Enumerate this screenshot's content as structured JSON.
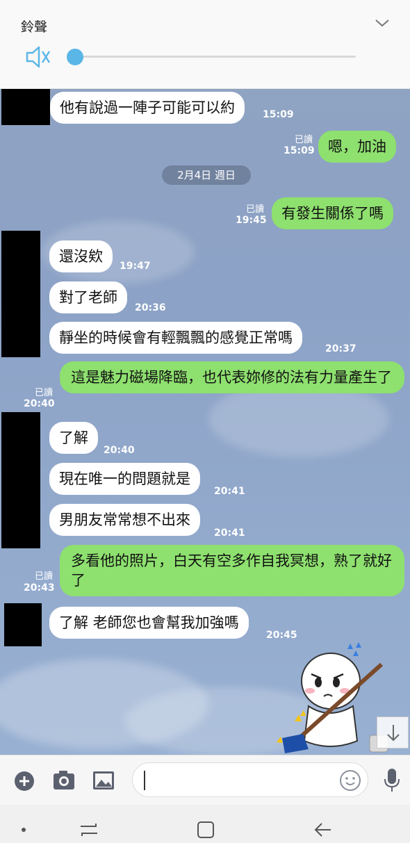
{
  "volume": {
    "title": "鈴聲",
    "level": 0.0,
    "muted": true
  },
  "chat": {
    "date_divider": "2月4日 週日",
    "messages": [
      {
        "side": "in",
        "text": "他有說過一陣子可能可以約",
        "time": "15:09"
      },
      {
        "side": "out",
        "text": "嗯，加油",
        "time": "15:09",
        "read": "已讀"
      },
      {
        "side": "out",
        "text": "有發生關係了嗎",
        "time": "19:45",
        "read": "已讀"
      },
      {
        "side": "in",
        "text": "還沒欸",
        "time": "19:47"
      },
      {
        "side": "in",
        "text": "對了老師",
        "time": "20:36"
      },
      {
        "side": "in",
        "text": "靜坐的時候會有輕飄飄的感覺正常嗎",
        "time": "20:37"
      },
      {
        "side": "out",
        "text": "這是魅力磁場降臨，也代表妳修的法有力量產生了",
        "time": "20:40",
        "read": "已讀"
      },
      {
        "side": "in",
        "text": "了解",
        "time": "20:40"
      },
      {
        "side": "in",
        "text": "現在唯一的問題就是",
        "time": "20:41"
      },
      {
        "side": "in",
        "text": "男朋友常常想不出來",
        "time": "20:41"
      },
      {
        "side": "out",
        "text": "多看他的照片，白天有空多作自我冥想，熟了就好了",
        "time": "20:43",
        "read": "已讀"
      },
      {
        "side": "in",
        "text": "了解 老師您也會幫我加強嗎",
        "time": "20:45"
      }
    ]
  },
  "input": {
    "value": "",
    "placeholder": ""
  },
  "icons": {
    "chevron": "chevron-down-icon",
    "mute": "volume-mute-icon",
    "plus": "plus-icon",
    "camera": "camera-icon",
    "image": "image-icon",
    "emoji": "emoji-icon",
    "mic": "microphone-icon",
    "scroll": "arrow-down-icon",
    "nav_recent": "recent-apps-icon",
    "nav_home": "home-icon",
    "nav_back": "back-icon"
  },
  "colors": {
    "incoming_bubble": "#ffffff",
    "outgoing_bubble": "#8ee06f",
    "slider_accent": "#5ab6e6"
  }
}
